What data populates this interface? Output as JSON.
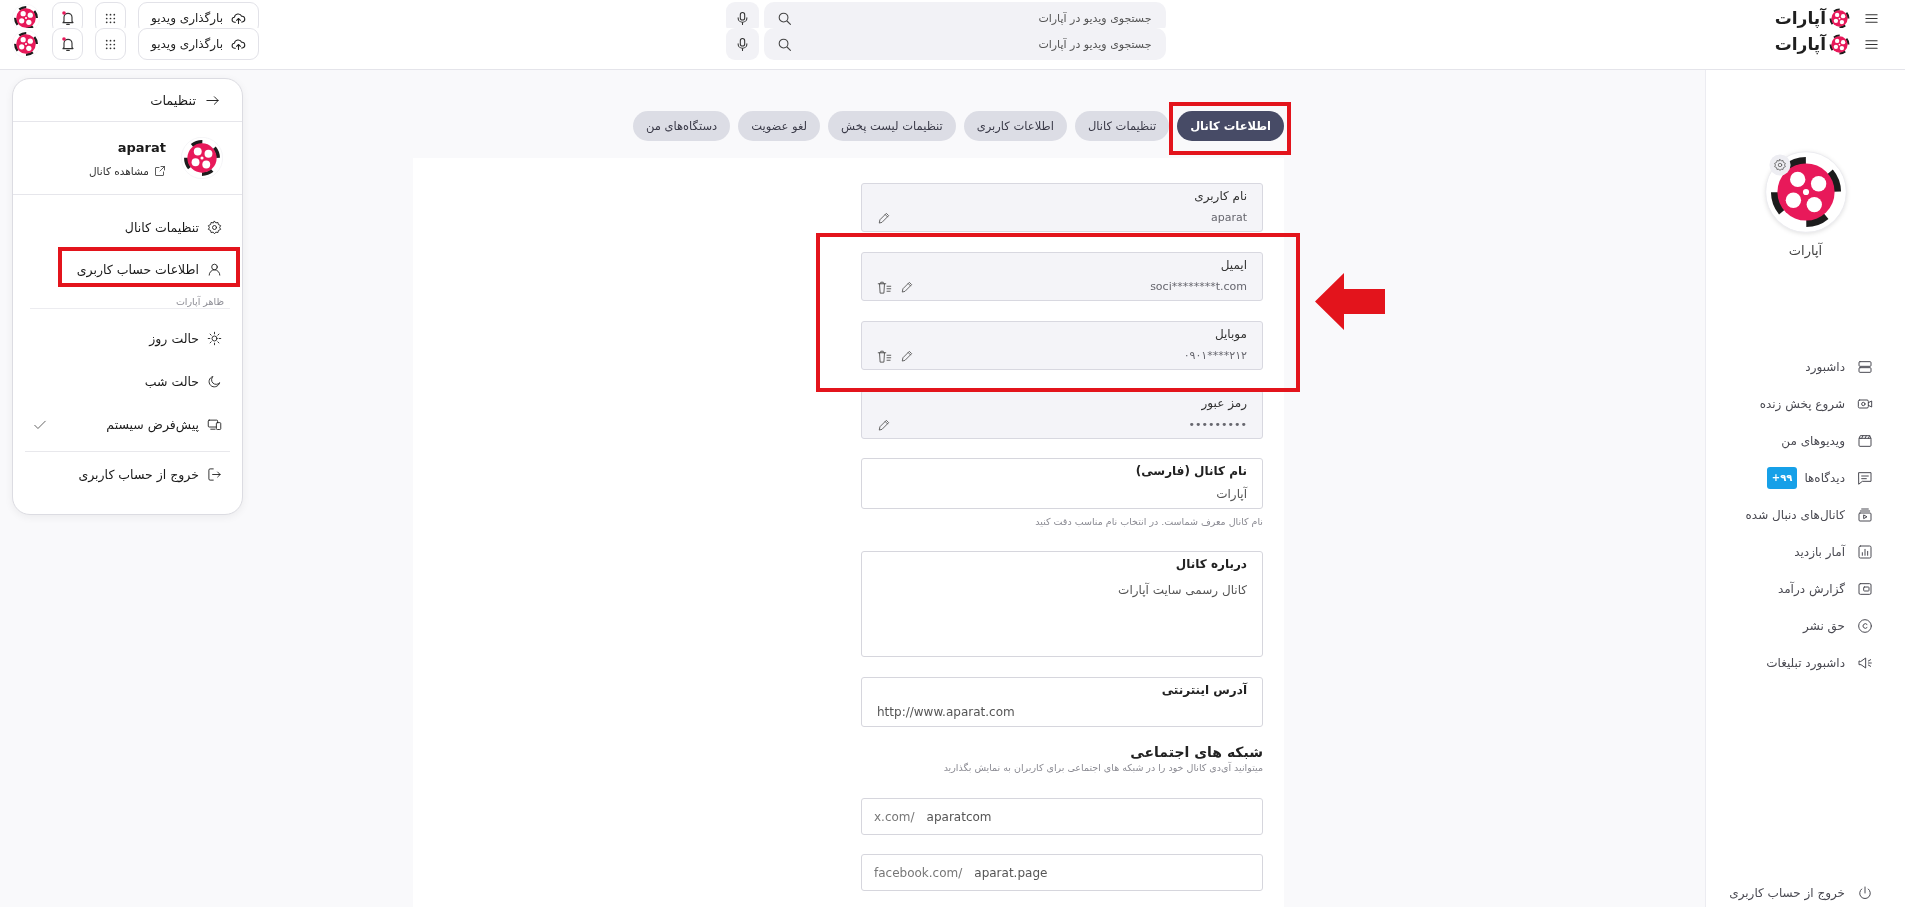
{
  "headers": [
    {
      "kind": "clipped",
      "logo_text": "آپارات",
      "search": {
        "placeholder": "جستجوی ویدیو در آپارات"
      },
      "upload_button": "بارگذاری ویدیو",
      "notifications_unread": true
    },
    {
      "kind": "full",
      "logo_text": "آپارات",
      "search": {
        "placeholder": "جستجوی ویدیو در آپارات"
      },
      "upload_button": "بارگذاری ویدیو",
      "notifications_unread": true
    }
  ],
  "settings_menu": {
    "title": "تنظیمات",
    "profile": {
      "name": "aparat",
      "link": "مشاهده کانال"
    },
    "items": [
      {
        "label": "تنظیمات کانال",
        "highlighted": false
      },
      {
        "label": "اطلاعات حساب کاربری",
        "highlighted": true
      }
    ],
    "appearance": {
      "label": "ظاهر آپارات",
      "options": [
        {
          "label": "حالت روز",
          "selected": false
        },
        {
          "label": "حالت شب",
          "selected": false
        },
        {
          "label": "پیش‌فرض سیستم",
          "selected": true
        }
      ]
    },
    "logout": "خروج از حساب کاربری"
  },
  "tabs": [
    {
      "label": "اطلاعات کانال",
      "selected": true,
      "highlighted": true
    },
    {
      "label": "تنظیمات کانال",
      "selected": false,
      "highlighted": false
    },
    {
      "label": "اطلاعات کاربری",
      "selected": false,
      "highlighted": false
    },
    {
      "label": "تنظیمات لیست پخش",
      "selected": false,
      "highlighted": false
    },
    {
      "label": "لغو عضویت",
      "selected": false,
      "highlighted": false
    },
    {
      "label": "دستگاه‌های من",
      "selected": false,
      "highlighted": false
    }
  ],
  "form": {
    "account_fields": [
      {
        "label": "نام کاربری",
        "value": "aparat",
        "deletable": false,
        "highlighted": false
      },
      {
        "label": "ایمیل",
        "value": "soci********t.com",
        "deletable": true,
        "highlighted": true
      },
      {
        "label": "موبایل",
        "value": "۰۹۰۱****۲۱۲",
        "deletable": true,
        "highlighted": true
      },
      {
        "label": "رمز عبور",
        "value": "•••••••••",
        "deletable": false,
        "highlighted": false
      }
    ],
    "highlight_arrow": true,
    "channel_name": {
      "label": "نام کانال (فارسی)",
      "value": "آپارات",
      "hint": "نام کانال معرف شماست. در انتخاب نام مناسب دقت کنید"
    },
    "about": {
      "label": "درباره کانال",
      "value": "کانال رسمی سایت آپارات"
    },
    "website": {
      "label": "آدرس اینترنتی",
      "value": "http://www.aparat.com"
    },
    "social": {
      "title": "شبکه های اجتماعی",
      "description": "میتوانید آی‌دی کانال خود را در شبکه های اجتماعی برای کاربران به نمایش بگذارید",
      "links": [
        {
          "prefix": "x.com/",
          "value": "aparatcom"
        },
        {
          "prefix": "facebook.com/",
          "value": "aparat.page"
        }
      ]
    }
  },
  "sidebar": {
    "channel_name": "آپارات",
    "items": [
      {
        "label": "داشبورد",
        "selected": false
      },
      {
        "label": "شروع پخش زنده",
        "selected": false
      },
      {
        "label": "ویدیوهای من",
        "selected": false
      },
      {
        "label": "دیدگاه‌ها",
        "badge": "۹۹+",
        "selected": false
      },
      {
        "label": "کانال‌های دنبال شده",
        "selected": false
      },
      {
        "label": "آمار بازدید",
        "selected": false
      },
      {
        "label": "گزارش درآمد",
        "selected": false
      },
      {
        "label": "حق نشر",
        "selected": false
      },
      {
        "label": "داشبورد تبلیغات",
        "selected": false
      }
    ],
    "logout": "خروج از حساب کاربری"
  }
}
